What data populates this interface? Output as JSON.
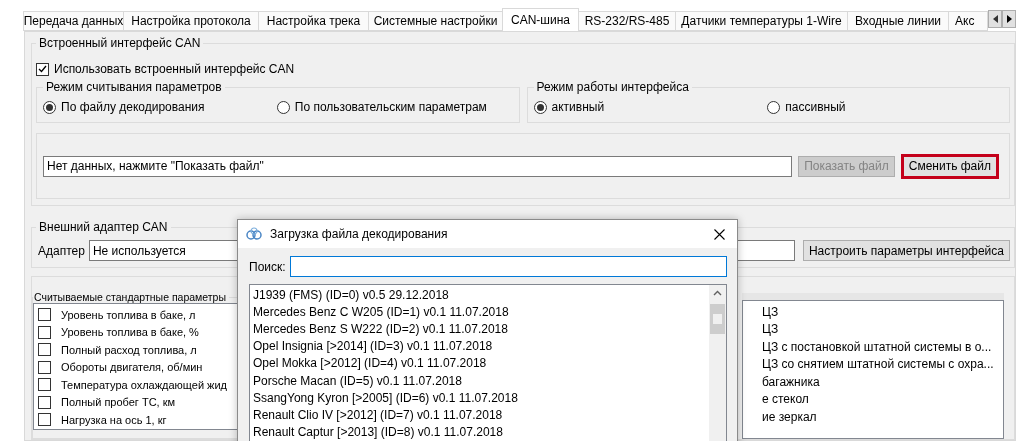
{
  "tabs": [
    {
      "label": "Передача данных",
      "selected": false
    },
    {
      "label": "Настройка протокола",
      "selected": false
    },
    {
      "label": "Настройка трека",
      "selected": false
    },
    {
      "label": "Системные настройки",
      "selected": false
    },
    {
      "label": "CAN-шина",
      "selected": true
    },
    {
      "label": "RS-232/RS-485",
      "selected": false
    },
    {
      "label": "Датчики температуры 1-Wire",
      "selected": false
    },
    {
      "label": "Входные линии",
      "selected": false
    },
    {
      "label": "Акс",
      "selected": false
    }
  ],
  "builtin_can": {
    "title": "Встроенный интерфейс CAN",
    "use_checkbox": {
      "label": "Использовать встроенный интерфейс CAN",
      "checked": true
    },
    "read_mode": {
      "title": "Режим считывания параметров",
      "options": [
        {
          "label": "По файлу декодирования",
          "selected": true
        },
        {
          "label": "По пользовательским параметрам",
          "selected": false
        }
      ]
    },
    "work_mode": {
      "title": "Режим работы интерфейса",
      "options": [
        {
          "label": "активный",
          "selected": true
        },
        {
          "label": "пассивный",
          "selected": false
        }
      ]
    },
    "file_field": {
      "value": "Нет данных, нажмите \"Показать файл\""
    },
    "show_button": {
      "label": "Показать файл",
      "disabled": true
    },
    "change_button": {
      "label": "Сменить файл",
      "focused": true
    }
  },
  "external_can": {
    "title": "Внешний адаптер CAN",
    "adapter_label": "Адаптер",
    "adapter_value": "Не используется",
    "config_button": "Настроить параметры интерфейса"
  },
  "standard_params": {
    "title": "Считываемые стандартные параметры",
    "items": [
      {
        "label": "Уровень топлива в баке, л",
        "checked": false
      },
      {
        "label": "Уровень топлива в баке, %",
        "checked": false
      },
      {
        "label": "Полный расход топлива, л",
        "checked": false
      },
      {
        "label": "Обороты двигателя, об/мин",
        "checked": false
      },
      {
        "label": "Температура охлаждающей жид",
        "checked": false
      },
      {
        "label": "Полный пробег ТС, км",
        "checked": false
      },
      {
        "label": "Нагрузка на ось 1, кг",
        "checked": false
      }
    ]
  },
  "right_list": {
    "items": [
      "ЦЗ",
      "ЦЗ",
      "ЦЗ с постановкой штатной системы в о...",
      "ЦЗ со снятием штатной системы с охра...",
      "багажника",
      "е стекол",
      "ие зеркал"
    ]
  },
  "dialog": {
    "title": "Загрузка файла декодирования",
    "search_label": "Поиск:",
    "files": [
      "J1939 (FMS) (ID=0) v0.5 29.12.2018",
      "Mercedes Benz C W205 (ID=1) v0.1 11.07.2018",
      "Mercedes Benz S W222 (ID=2) v0.1 11.07.2018",
      "Opel Insignia [>2014] (ID=3) v0.1 11.07.2018",
      "Opel Mokka [>2012] (ID=4) v0.1 11.07.2018",
      "Porsche Macan (ID=5) v0.1 11.07.2018",
      "SsangYong Kyron [>2005] (ID=6) v0.1 11.07.2018",
      "Renault Clio IV [>2012] (ID=7) v0.1 11.07.2018",
      "Renault Captur [>2013] (ID=8) v0.1 11.07.2018"
    ]
  }
}
